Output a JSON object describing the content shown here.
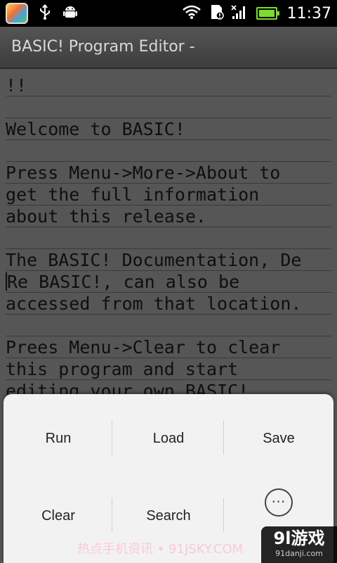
{
  "status_bar": {
    "time": "11:37",
    "left_icons": [
      "app-icon",
      "usb-icon",
      "android-debug-icon"
    ],
    "right_icons": [
      "wifi-icon",
      "sd-card-icon",
      "no-signal-icon",
      "battery-icon"
    ]
  },
  "title_bar": {
    "title": "BASIC! Program Editor -"
  },
  "editor": {
    "lines": [
      "!!",
      "",
      "Welcome to BASIC!",
      "",
      "Press Menu->More->About to",
      "get the full information",
      "about this release.",
      "",
      "The BASIC! Documentation, De",
      "Re BASIC!, can also be",
      "accessed from that location.",
      "",
      "Prees Menu->Clear to clear",
      "this program and start",
      "editing your own BASIC!"
    ]
  },
  "options_menu": {
    "items": [
      {
        "label": "Run"
      },
      {
        "label": "Load"
      },
      {
        "label": "Save"
      },
      {
        "label": "Clear"
      },
      {
        "label": "Search"
      },
      {
        "label": "⋯"
      }
    ]
  },
  "watermark": {
    "left_text": "热点手机资讯 • 91JSKY.COM",
    "brand": "9l游戏",
    "url": "91danji.com"
  }
}
